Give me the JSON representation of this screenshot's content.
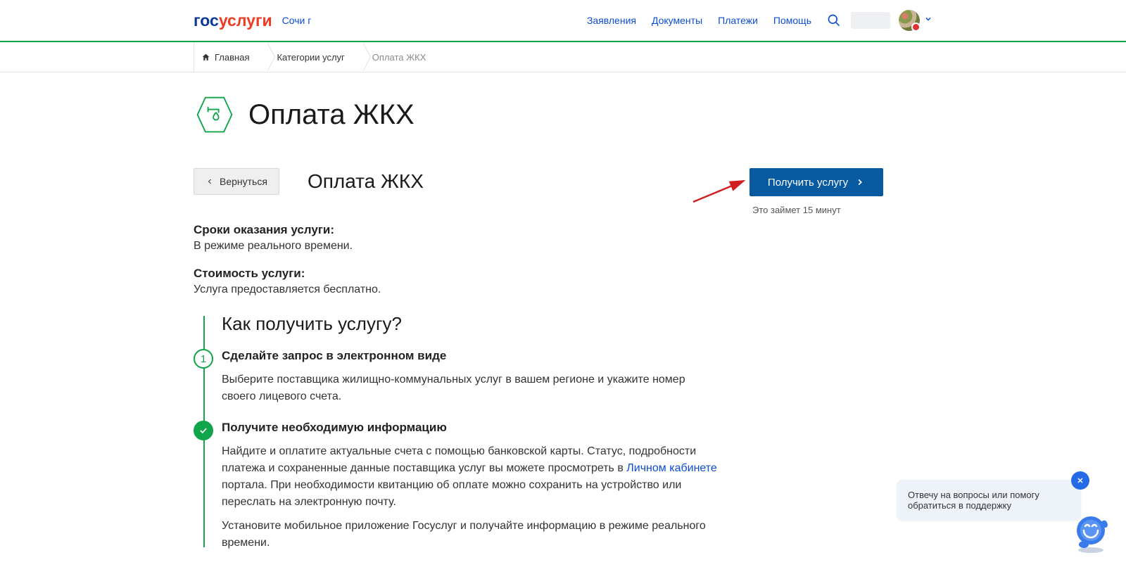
{
  "logo": {
    "part1": "гос",
    "part2": "услуги"
  },
  "city": "Сочи г",
  "nav": {
    "applications": "Заявления",
    "documents": "Документы",
    "payments": "Платежи",
    "help": "Помощь"
  },
  "breadcrumbs": {
    "home": "Главная",
    "categories": "Категории услуг",
    "current": "Оплата ЖКХ"
  },
  "page_title": "Оплата ЖКХ",
  "sub_title": "Оплата ЖКХ",
  "back_label": "Вернуться",
  "defs": {
    "term1": "Сроки оказания услуги:",
    "val1": "В режиме реального времени.",
    "term2": "Стоимость услуги:",
    "val2": "Услуга предоставляется бесплатно."
  },
  "steps": {
    "heading": "Как получить услугу?",
    "s1_title": "Сделайте запрос в электронном виде",
    "s1_body": "Выберите поставщика жилищно-коммунальных услуг в вашем регионе и укажите номер своего лицевого счета.",
    "s2_title": "Получите необходимую информацию",
    "s2_body_a": "Найдите и оплатите актуальные счета с помощью банковской карты. Статус, подробности платежа и сохраненные данные поставщика услуг вы можете просмотреть в ",
    "s2_link": "Личном кабинете",
    "s2_body_b": " портала. При необходимости квитанцию об оплате можно сохранить на устройство или переслать на электронную почту.",
    "s2_body2": "Установите мобильное приложение Госуслуг и получайте информацию в режиме реального времени."
  },
  "action": {
    "label": "Получить услугу",
    "note": "Это займет 15 минут"
  },
  "chat": {
    "text": "Отвечу на вопросы или помогу обратиться в поддержку"
  }
}
